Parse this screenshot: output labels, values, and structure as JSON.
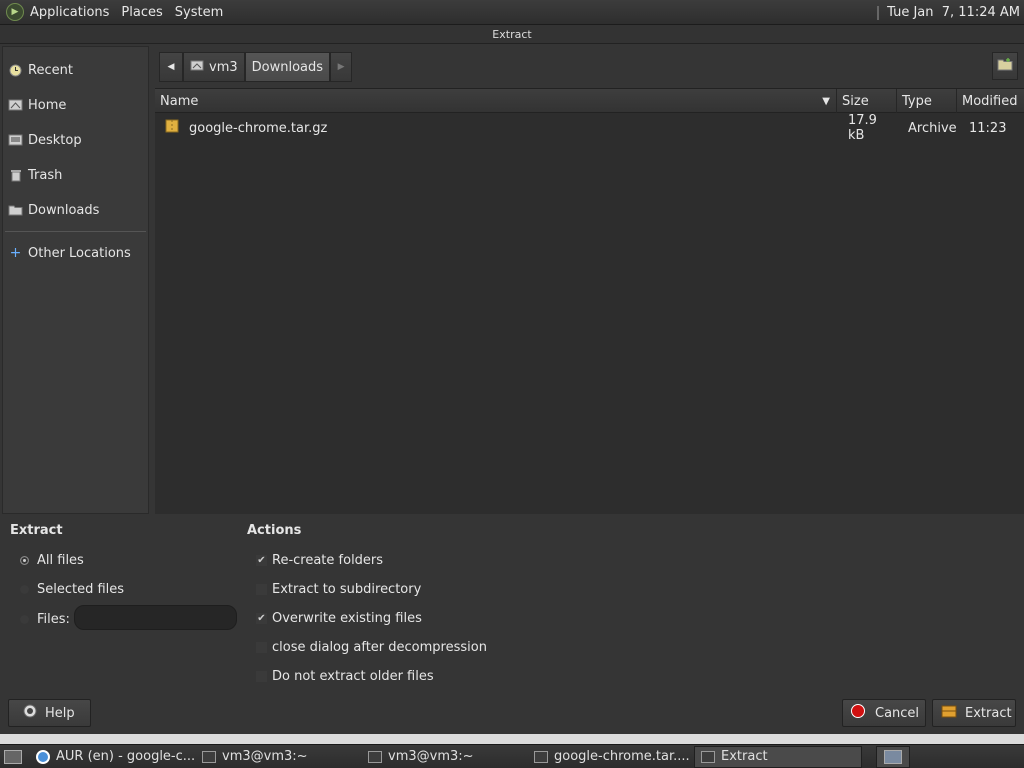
{
  "top_panel": {
    "menus": [
      "Applications",
      "Places",
      "System"
    ],
    "clock": "Tue Jan  7, 11:24 AM"
  },
  "window": {
    "title": "Extract"
  },
  "sidebar": {
    "items": [
      {
        "label": "Recent",
        "icon": "clock-icon"
      },
      {
        "label": "Home",
        "icon": "home-icon"
      },
      {
        "label": "Desktop",
        "icon": "desktop-icon"
      },
      {
        "label": "Trash",
        "icon": "trash-icon"
      },
      {
        "label": "Downloads",
        "icon": "folder-icon"
      }
    ],
    "other_locations": "Other Locations"
  },
  "path_bar": {
    "segments": [
      "vm3",
      "Downloads"
    ]
  },
  "file_list": {
    "columns": [
      "Name",
      "Size",
      "Type",
      "Modified"
    ],
    "rows": [
      {
        "name": "google-chrome.tar.gz",
        "size": "17.9 kB",
        "type": "Archive",
        "modified": "11:23"
      }
    ]
  },
  "extract": {
    "title": "Extract",
    "all_files": "All files",
    "selected_files": "Selected files",
    "files_label": "Files:",
    "files_value": "",
    "selected": "all_files"
  },
  "actions": {
    "title": "Actions",
    "options": [
      {
        "label": "Re-create folders",
        "checked": true
      },
      {
        "label": "Extract to subdirectory",
        "checked": false
      },
      {
        "label": "Overwrite existing files",
        "checked": true
      },
      {
        "label": "close dialog after decompression",
        "checked": false
      },
      {
        "label": "Do not extract older files",
        "checked": false
      }
    ]
  },
  "buttons": {
    "help": "Help",
    "cancel": "Cancel",
    "extract": "Extract"
  },
  "taskbar": {
    "items": [
      {
        "label": "AUR (en) - google-c...",
        "active": false
      },
      {
        "label": "vm3@vm3:~",
        "active": false
      },
      {
        "label": "vm3@vm3:~",
        "active": false
      },
      {
        "label": "google-chrome.tar....",
        "active": false
      },
      {
        "label": "Extract",
        "active": true
      }
    ]
  },
  "colors": {
    "cancel_red": "#d01010",
    "folder_yellow": "#e0b040"
  }
}
